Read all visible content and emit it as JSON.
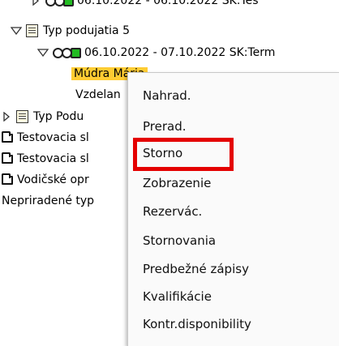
{
  "tree": {
    "partial_top_text": "06.10.2022 - 06.10.2022 SK:Tes",
    "event_type_5": "Typ podujatia 5",
    "event_row": "06.10.2022 - 07.10.2022 SK:Term",
    "participant_1": "Múdra Mária",
    "participant_2": "Vzdelan",
    "event_type_other": "Typ Podu",
    "folder_1": "Testovacia sl",
    "folder_2": "Testovacia sl",
    "folder_3": "Vodičské opr",
    "unassigned": "Nepriradené typ"
  },
  "context_menu": {
    "items": [
      "Nahrad.",
      "Prerad.",
      "Storno",
      "Zobrazenie",
      "Rezervác.",
      "Stornovania",
      "Predbežné zápisy",
      "Kvalifikácie",
      "Kontr.disponibility"
    ],
    "highlighted_item": "Storno",
    "highlight_color": "#e40000"
  },
  "colors": {
    "selection_highlight": "#ffcc33",
    "traffic_light_green": "#22bb22"
  }
}
